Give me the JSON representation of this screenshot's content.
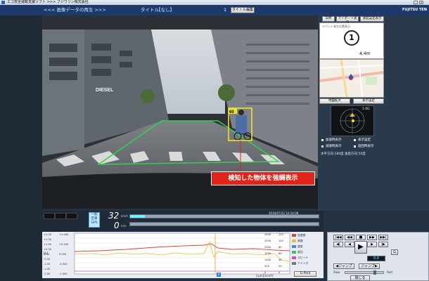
{
  "window": {
    "title": "エコ安全運転支援ソフト >>> フジウリン株式会社"
  },
  "header": {
    "breadcrumb": "<<<  画像データの再生  >>>",
    "title_label": "タイトル",
    "title_value": "【なし】",
    "page_indicator": "1",
    "title_edit_button": "タイトル編集",
    "logo_text": "FUJITSU TEN"
  },
  "side": {
    "tabs": [
      "日時",
      "マイポート表示",
      "速度設定表示"
    ],
    "event_label": "イベント発生位置表示",
    "event_number": "1",
    "distance": "4.4m",
    "map_buttons": [
      "地図拡大",
      "表示設定"
    ],
    "gsensor_value": "1.0G",
    "checkboxes": [
      {
        "label": "加速時表示",
        "checked": false
      },
      {
        "label": "減速時表示",
        "checked": true
      },
      {
        "label": "表示設定",
        "checked": false
      },
      {
        "label": "旋回時表示",
        "checked": false
      }
    ],
    "bottom_note": "水平方向:180度  垂直方向:50度"
  },
  "video": {
    "annotation_label": "検知した物体を強調表示",
    "detect_badge": "60",
    "shop_sign": "DIESEL"
  },
  "speed": {
    "mode_label_1": "一般",
    "mode_label_2": "空車",
    "gps_label": "GPS",
    "speed_value": "32",
    "speed_unit": "km/h",
    "rpm_value": "0",
    "rpm_unit": "min",
    "progress_fraction": 0.08,
    "timestamp": "2010/07/22 10:14:08"
  },
  "graph": {
    "y_left_1": [
      "+2.00",
      "+1.50",
      "+1.00",
      "+0.50",
      "0.00",
      "-0.50",
      "-1.00",
      "-1.50",
      "-2.00"
    ],
    "y_left_2": [
      "+1.000",
      "+0.500",
      "0.000",
      "-0.500",
      "-1.000"
    ],
    "y_right_1": [
      "3000",
      "2500",
      "2000",
      "1500",
      "1000",
      "500",
      "0"
    ],
    "y_right_2": [
      "120",
      "100",
      "80",
      "60",
      "40",
      "20",
      "0"
    ],
    "units_left": "[G]",
    "units_right": "[rpm][km/h]",
    "legend": [
      "加速度",
      "減速",
      "速度",
      "旋回",
      "スピード",
      "ナイトボ"
    ],
    "gpara_label": "G-Para",
    "cursor_marker": "0"
  },
  "controls": {
    "buttons_row1": [
      "|◀◀",
      "◀◀",
      "■",
      "▶▶",
      "▶▶|"
    ],
    "buttons_row2": [
      "◀|",
      "◀",
      "▶",
      "|▶"
    ],
    "play_icon": "▶",
    "g_label": "G",
    "counter": "0.0",
    "jump_prev": "◀ジャンプ",
    "jump_next": "ジャンプ▶",
    "slow_label": "Slow",
    "fast_label": "Fast",
    "close_button": "閉じる"
  },
  "colors": {
    "header_bg": "#1d3a6a",
    "annotation_red": "#e2231a",
    "detect_yellow": "#f3e12b",
    "lane_green": "#33d24a",
    "graph_red": "#d9443a",
    "graph_yellow": "#e2c23a",
    "graph_magenta": "#d24ad2"
  }
}
